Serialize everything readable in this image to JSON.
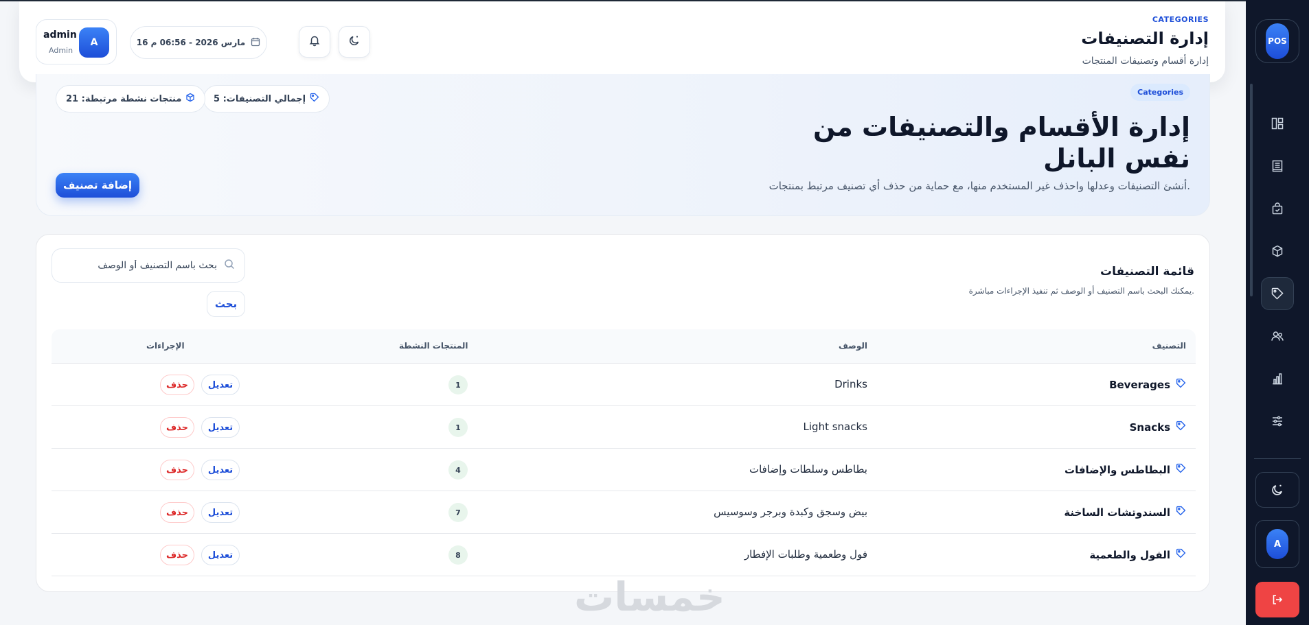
{
  "header": {
    "kicker": "CATEGORIES",
    "title": "إدارة التصنيفات",
    "subtitle": "إدارة أقسام وتصنيفات المنتجات",
    "date": "16 مارس 2026 - 06:56 م",
    "user": {
      "initial": "A",
      "name": "admin",
      "role": "Admin"
    }
  },
  "hero": {
    "badge": "Categories",
    "title": "إدارة الأقسام والتصنيفات من نفس البانل",
    "description": "أنشئ التصنيفات وعدلها واحذف غير المستخدم منها، مع حماية من حذف أي تصنيف مرتبط بمنتجات.",
    "total_categories": "إجمالي التصنيفات: 5",
    "linked_products": "منتجات نشطة مرتبطة: 21",
    "add_button": "إضافة تصنيف"
  },
  "list": {
    "title": "قائمة التصنيفات",
    "subtitle": "يمكنك البحث باسم التصنيف أو الوصف ثم تنفيذ الإجراءات مباشرة.",
    "search_placeholder": "بحث باسم التصنيف أو الوصف",
    "search_button": "بحث",
    "columns": {
      "name": "التصنيف",
      "description": "الوصف",
      "active_products": "المنتجات النشطة",
      "actions": "الإجراءات"
    },
    "rows": [
      {
        "name": "Beverages",
        "description": "Drinks",
        "count": "1",
        "edit": "تعديل",
        "delete": "حذف"
      },
      {
        "name": "Snacks",
        "description": "Light snacks",
        "count": "1",
        "edit": "تعديل",
        "delete": "حذف"
      },
      {
        "name": "البطاطس والإضافات",
        "description": "بطاطس وسلطات وإضافات",
        "count": "4",
        "edit": "تعديل",
        "delete": "حذف"
      },
      {
        "name": "السندوتشات الساخنة",
        "description": "بيض وسجق وكبدة وبرجر وسوسيس",
        "count": "7",
        "edit": "تعديل",
        "delete": "حذف"
      },
      {
        "name": "الفول والطعمية",
        "description": "فول وطعمية وطلبات الإفطار",
        "count": "8",
        "edit": "تعديل",
        "delete": "حذف"
      }
    ]
  },
  "sidebar": {
    "logo": "POS",
    "user_initial": "A",
    "items": [
      "dashboard-icon",
      "receipt-icon",
      "shopping-bag-icon",
      "box-icon",
      "tag-icon",
      "users-icon",
      "chart-icon",
      "sliders-icon"
    ],
    "active": "tag-icon"
  },
  "watermark": "خمسات",
  "colors": {
    "accent": "#2563eb",
    "danger": "#dc2626",
    "sidebar": "#0f172a"
  }
}
